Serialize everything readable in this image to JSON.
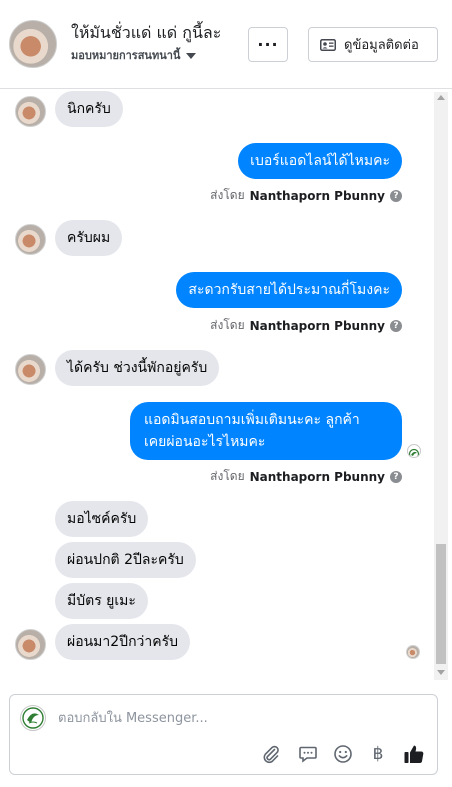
{
  "header": {
    "name": "ให้มันชั่วแด่ แด่ กูนี้ละ",
    "subtitle": "มอบหมายการสนทนานี้",
    "more_label": "···",
    "profile_button": "ดูข้อมูลติดต่อ"
  },
  "messages": [
    {
      "id": "m1",
      "direction": "incoming",
      "text": "นิกครับ"
    },
    {
      "id": "m2",
      "direction": "outgoing",
      "text": "เบอร์แอดไลน์ได้ไหมคะ"
    },
    {
      "id": "m3",
      "direction": "incoming",
      "text": "ครับผม"
    },
    {
      "id": "m4",
      "direction": "outgoing",
      "text": "สะดวกรับสายได้ประมาณกี่โมงคะ"
    },
    {
      "id": "m5",
      "direction": "incoming",
      "text": "ได้ครับ ช่วงนี้พักอยู่ครับ"
    },
    {
      "id": "m6",
      "direction": "outgoing",
      "line1": "แอดมินสอบถามเพิ่มเติมนะคะ ลูกค้า",
      "line2": "เคยผ่อนอะไรไหมคะ"
    },
    {
      "id": "m7",
      "direction": "incoming",
      "text": "มอไซค์ครับ"
    },
    {
      "id": "m8",
      "direction": "incoming",
      "text": "ผ่อนปกติ 2ปีละครับ"
    },
    {
      "id": "m9",
      "direction": "incoming",
      "text": "มีบัตร ยูเมะ"
    },
    {
      "id": "m10",
      "direction": "incoming",
      "text": "ผ่อนมา2ปีกว่าครับ"
    }
  ],
  "sent_by": {
    "prefix": "ส่งโดย",
    "sender": "Nanthaporn Pbunny",
    "help": "?"
  },
  "composer": {
    "placeholder": "ตอบกลับใน Messenger...",
    "baht_symbol": "฿"
  },
  "colors": {
    "outgoing_bubble": "#0084ff",
    "incoming_bubble": "#e4e6eb",
    "like_icon": "#1c1e21"
  }
}
